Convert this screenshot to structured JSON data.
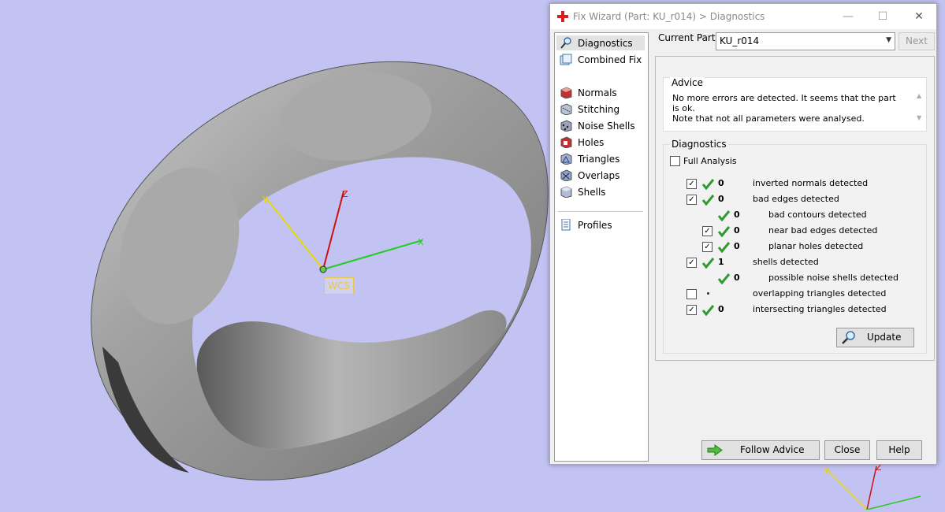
{
  "viewport": {
    "wcs_label": "WCS",
    "axis_y": "Y",
    "axis_z": "Z",
    "axis_x": "X",
    "colors": {
      "background": "#c3c3f3",
      "axis_x": "#22cc22",
      "axis_y": "#e6d800",
      "axis_z": "#cc1111"
    }
  },
  "dialog": {
    "title": "Fix Wizard (Part: KU_r014) > Diagnostics",
    "title_icon": "red-cross-icon",
    "window_controls": [
      "minimize",
      "maximize",
      "close"
    ],
    "nav": {
      "items": [
        {
          "label": "Diagnostics",
          "icon": "magnifier-icon",
          "selected": true
        },
        {
          "label": "Combined Fix",
          "icon": "combined-fix-icon"
        },
        {
          "label": "Normals",
          "icon": "normals-icon"
        },
        {
          "label": "Stitching",
          "icon": "stitching-icon"
        },
        {
          "label": "Noise Shells",
          "icon": "noise-shells-icon"
        },
        {
          "label": "Holes",
          "icon": "holes-icon"
        },
        {
          "label": "Triangles",
          "icon": "triangles-icon"
        },
        {
          "label": "Overlaps",
          "icon": "overlaps-icon"
        },
        {
          "label": "Shells",
          "icon": "shells-icon"
        },
        {
          "label": "Profiles",
          "icon": "profiles-icon"
        }
      ]
    },
    "current_part_label": "Current Part:",
    "current_part_value": "KU_r014",
    "next_label": "Next",
    "advice": {
      "title": "Advice",
      "text_line1": "No more errors are detected. It seems that the part is ok.",
      "text_line2": "Note that not all parameters were analysed."
    },
    "diagnostics": {
      "title": "Diagnostics",
      "full_analysis_label": "Full Analysis",
      "rows": [
        {
          "checked": true,
          "count": "0",
          "label": "inverted normals detected"
        },
        {
          "checked": true,
          "count": "0",
          "label": "bad edges detected"
        },
        {
          "count": "0",
          "label": "bad contours detected"
        },
        {
          "checked": true,
          "count": "0",
          "label": "near bad edges detected"
        },
        {
          "checked": true,
          "count": "0",
          "label": "planar holes detected"
        },
        {
          "checked": true,
          "count": "1",
          "label": "shells detected"
        },
        {
          "count": "0",
          "label": "possible noise shells detected"
        },
        {
          "checked": false,
          "label": "overlapping triangles detected"
        },
        {
          "checked": true,
          "count": "0",
          "label": "intersecting triangles detected"
        }
      ],
      "update_label": "Update"
    },
    "buttons": {
      "follow_advice": "Follow Advice",
      "close": "Close",
      "help": "Help"
    }
  }
}
